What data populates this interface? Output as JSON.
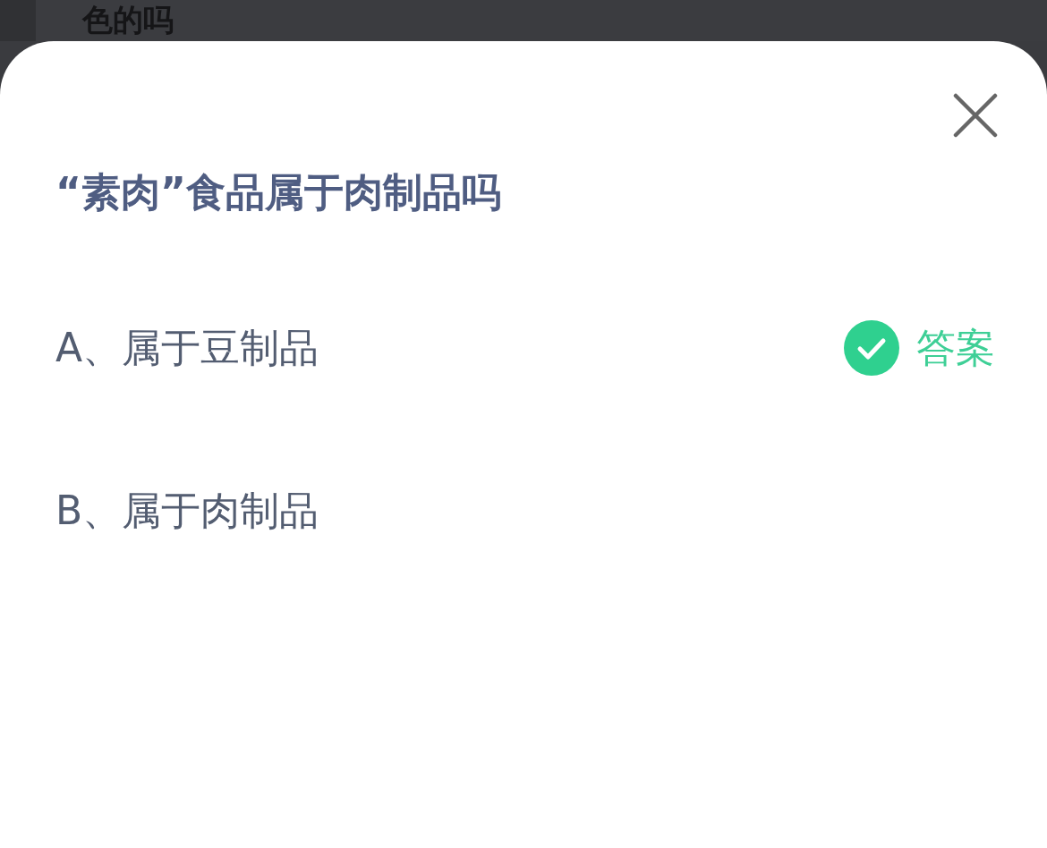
{
  "background_text": "色的吗",
  "sheet": {
    "question": "“素肉”食品属于肉制品吗",
    "options": [
      {
        "text": "A、属于豆制品",
        "correct": true,
        "badge": "答案"
      },
      {
        "text": "B、属于肉制品",
        "correct": false
      }
    ]
  }
}
